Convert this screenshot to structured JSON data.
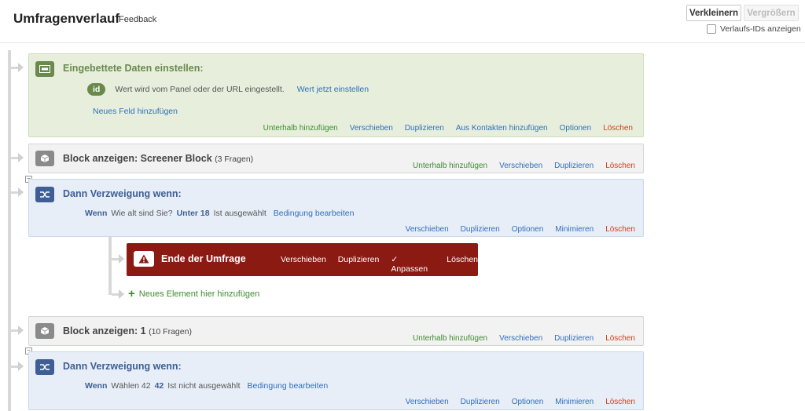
{
  "header": {
    "title": "Umfragenverlauf",
    "subtitle": "Feedback",
    "zoom_out_label": "Verkleinern",
    "zoom_in_label": "Vergrößern",
    "show_ids_label": "Verlaufs-IDs anzeigen"
  },
  "embedded": {
    "title": "Eingebettete Daten einstellen:",
    "field_tag": "id",
    "field_desc": "Wert wird vom Panel oder der URL eingestellt.",
    "set_value_link": "Wert jetzt einstellen",
    "add_field_link": "Neues Feld hinzufügen",
    "actions": [
      "Unterhalb hinzufügen",
      "Verschieben",
      "Duplizieren",
      "Aus Kontakten hinzufügen",
      "Optionen",
      "Löschen"
    ]
  },
  "block1": {
    "title": "Block anzeigen: Screener Block",
    "count": "(3 Fragen)",
    "actions": [
      "Unterhalb hinzufügen",
      "Verschieben",
      "Duplizieren",
      "Löschen"
    ]
  },
  "branch1": {
    "title": "Dann Verzweigung wenn:",
    "cond_if": "Wenn",
    "cond_question": "Wie alt sind Sie?",
    "cond_answer": "Unter 18",
    "cond_state": "Ist ausgewählt",
    "edit_link": "Bedingung bearbeiten",
    "actions": [
      "Verschieben",
      "Duplizieren",
      "Optionen",
      "Minimieren",
      "Löschen"
    ]
  },
  "end": {
    "title": "Ende der Umfrage",
    "move": "Verschieben",
    "duplicate": "Duplizieren",
    "customize": "✓ Anpassen",
    "delete": "Löschen"
  },
  "add_element": "Neues Element hier hinzufügen",
  "block2": {
    "title": "Block anzeigen: 1",
    "count": "(10 Fragen)",
    "actions": [
      "Unterhalb hinzufügen",
      "Verschieben",
      "Duplizieren",
      "Löschen"
    ]
  },
  "branch2": {
    "title": "Dann Verzweigung wenn:",
    "cond_if": "Wenn",
    "cond_question": "Wählen 42",
    "cond_answer": "42",
    "cond_state": "Ist nicht ausgewählt",
    "edit_link": "Bedingung bearbeiten",
    "actions": [
      "Verschieben",
      "Duplizieren",
      "Optionen",
      "Minimieren",
      "Löschen"
    ]
  },
  "colors": {
    "green_card": "#e7efdc",
    "blue_card": "#e8eef7",
    "grey_card": "#f2f2f2",
    "end_red": "#8b1a12",
    "link_blue": "#2f6ebd",
    "action_green": "#3d8b2f",
    "delete_red": "#d0401c"
  },
  "icons": {
    "embedded": "embedded-data-icon",
    "block": "block-cube-icon",
    "branch": "branch-icon",
    "end": "warning-icon",
    "add": "plus-icon"
  }
}
